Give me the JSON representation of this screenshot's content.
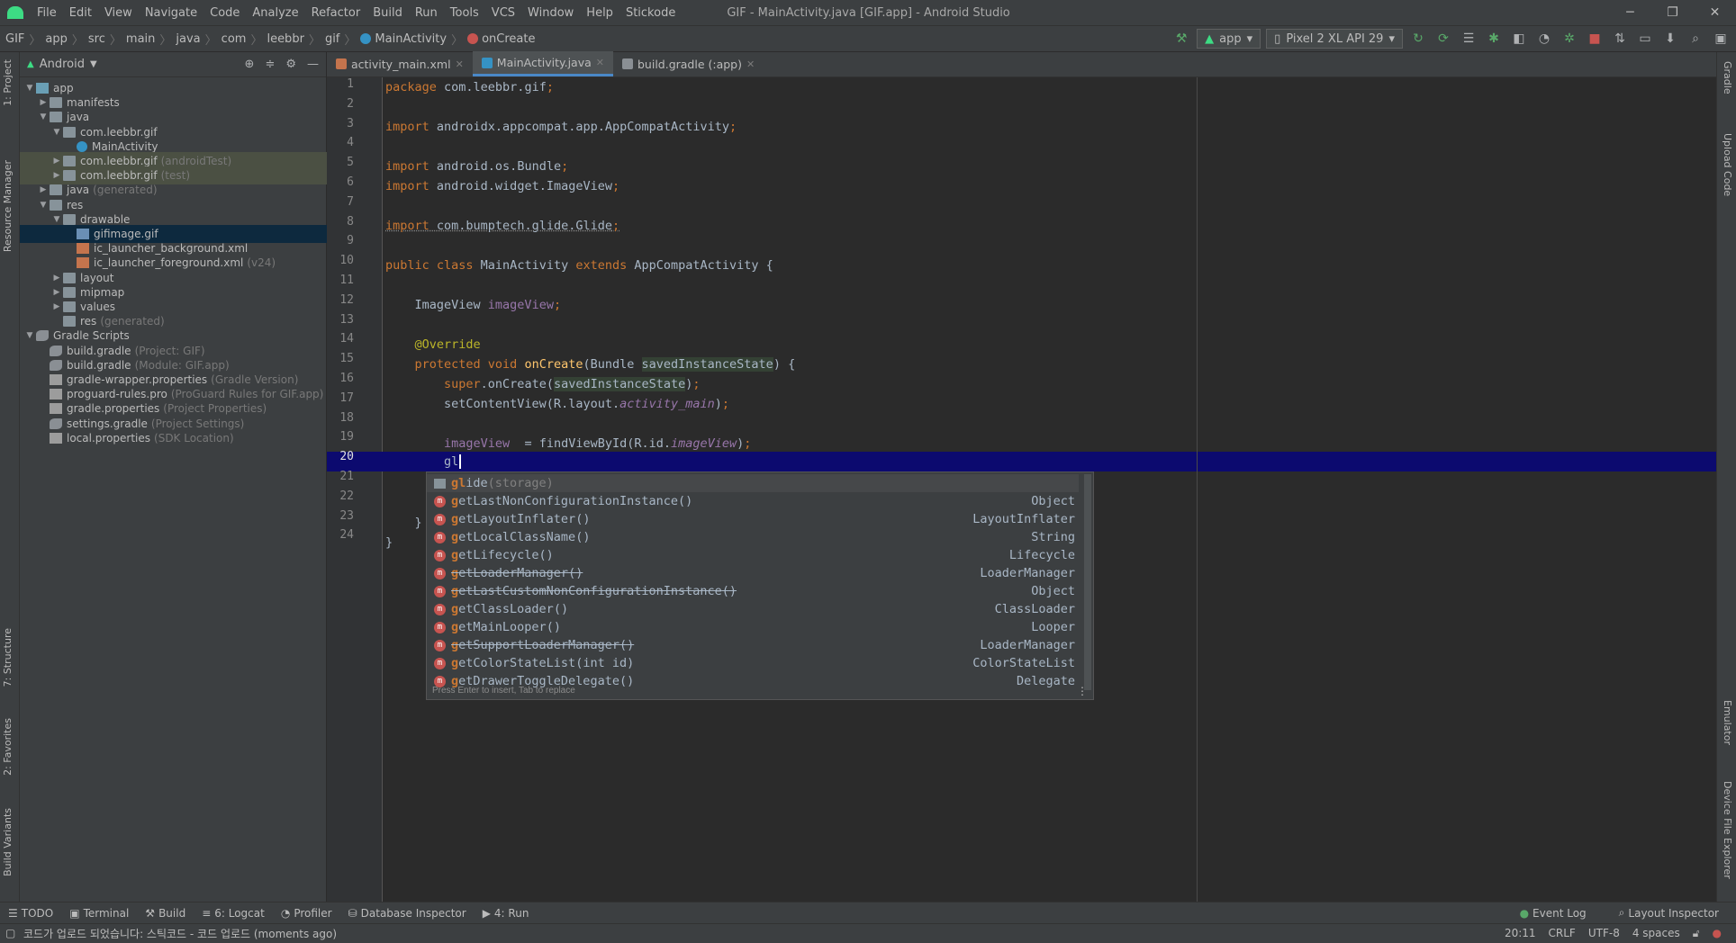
{
  "window": {
    "title": "GIF - MainActivity.java [GIF.app] - Android Studio",
    "menu": [
      "File",
      "Edit",
      "View",
      "Navigate",
      "Code",
      "Analyze",
      "Refactor",
      "Build",
      "Run",
      "Tools",
      "VCS",
      "Window",
      "Help",
      "Stickode"
    ],
    "controls": [
      "─",
      "❐",
      "✕"
    ]
  },
  "breadcrumb": [
    "GIF",
    "app",
    "src",
    "main",
    "java",
    "com",
    "leebbr",
    "gif",
    "MainActivity",
    "onCreate"
  ],
  "toolbar": {
    "config": "app",
    "device": "Pixel 2 XL API 29"
  },
  "side_tabs_left": [
    "1: Project",
    "Resource Manager",
    "7: Structure",
    "2: Favorites",
    "Build Variants"
  ],
  "side_tabs_right": [
    "Gradle",
    "Upload Code",
    "Emulator",
    "Device File Explorer"
  ],
  "project": {
    "view": "Android",
    "tree": [
      {
        "label": "app",
        "sub": "",
        "depth": 0,
        "arrow": "▼",
        "icon": "folder-blue"
      },
      {
        "label": "manifests",
        "sub": "",
        "depth": 1,
        "arrow": "▶",
        "icon": "folder"
      },
      {
        "label": "java",
        "sub": "",
        "depth": 1,
        "arrow": "▼",
        "icon": "folder"
      },
      {
        "label": "com.leebbr.gif",
        "sub": "",
        "depth": 2,
        "arrow": "▼",
        "icon": "folder"
      },
      {
        "label": "MainActivity",
        "sub": "",
        "depth": 3,
        "arrow": "",
        "icon": "jclass"
      },
      {
        "label": "com.leebbr.gif",
        "sub": "(androidTest)",
        "depth": 2,
        "arrow": "▶",
        "icon": "folder",
        "hl": "green"
      },
      {
        "label": "com.leebbr.gif",
        "sub": "(test)",
        "depth": 2,
        "arrow": "▶",
        "icon": "folder",
        "hl": "green"
      },
      {
        "label": "java",
        "sub": "(generated)",
        "depth": 1,
        "arrow": "▶",
        "icon": "folder"
      },
      {
        "label": "res",
        "sub": "",
        "depth": 1,
        "arrow": "▼",
        "icon": "folder"
      },
      {
        "label": "drawable",
        "sub": "",
        "depth": 2,
        "arrow": "▼",
        "icon": "folder"
      },
      {
        "label": "gifimage.gif",
        "sub": "",
        "depth": 3,
        "arrow": "",
        "icon": "gif",
        "hl": "sel"
      },
      {
        "label": "ic_launcher_background.xml",
        "sub": "",
        "depth": 3,
        "arrow": "",
        "icon": "xml"
      },
      {
        "label": "ic_launcher_foreground.xml",
        "sub": "(v24)",
        "depth": 3,
        "arrow": "",
        "icon": "xml"
      },
      {
        "label": "layout",
        "sub": "",
        "depth": 2,
        "arrow": "▶",
        "icon": "folder"
      },
      {
        "label": "mipmap",
        "sub": "",
        "depth": 2,
        "arrow": "▶",
        "icon": "folder"
      },
      {
        "label": "values",
        "sub": "",
        "depth": 2,
        "arrow": "▶",
        "icon": "folder"
      },
      {
        "label": "res",
        "sub": "(generated)",
        "depth": 2,
        "arrow": "",
        "icon": "folder"
      },
      {
        "label": "Gradle Scripts",
        "sub": "",
        "depth": 0,
        "arrow": "▼",
        "icon": "gradle"
      },
      {
        "label": "build.gradle",
        "sub": "(Project: GIF)",
        "depth": 1,
        "arrow": "",
        "icon": "gradle"
      },
      {
        "label": "build.gradle",
        "sub": "(Module: GIF.app)",
        "depth": 1,
        "arrow": "",
        "icon": "gradle"
      },
      {
        "label": "gradle-wrapper.properties",
        "sub": "(Gradle Version)",
        "depth": 1,
        "arrow": "",
        "icon": "prop"
      },
      {
        "label": "proguard-rules.pro",
        "sub": "(ProGuard Rules for GIF.app)",
        "depth": 1,
        "arrow": "",
        "icon": "prop"
      },
      {
        "label": "gradle.properties",
        "sub": "(Project Properties)",
        "depth": 1,
        "arrow": "",
        "icon": "prop"
      },
      {
        "label": "settings.gradle",
        "sub": "(Project Settings)",
        "depth": 1,
        "arrow": "",
        "icon": "gradle"
      },
      {
        "label": "local.properties",
        "sub": "(SDK Location)",
        "depth": 1,
        "arrow": "",
        "icon": "prop"
      }
    ]
  },
  "tabs": [
    {
      "label": "activity_main.xml",
      "active": false,
      "color": "#c4744d"
    },
    {
      "label": "MainActivity.java",
      "active": true,
      "color": "#3592c4"
    },
    {
      "label": "build.gradle (:app)",
      "active": false,
      "color": "#8a8f94"
    }
  ],
  "editor": {
    "current_line": 20,
    "line_numbers": [
      "1",
      "2",
      "3",
      "4",
      "5",
      "6",
      "7",
      "8",
      "9",
      "10",
      "11",
      "12",
      "13",
      "14",
      "15",
      "16",
      "17",
      "18",
      "19",
      "20",
      "21",
      "22",
      "23",
      "24"
    ]
  },
  "completion": {
    "items": [
      {
        "kind": "package",
        "prefix": "gl",
        "name": "ide",
        "params": "(storage)",
        "type": "",
        "deprecated": false
      },
      {
        "kind": "method",
        "prefix": "g",
        "name": "etLastNonConfigurationInstance",
        "params": "()",
        "type": "Object",
        "deprecated": false
      },
      {
        "kind": "method",
        "prefix": "g",
        "name": "etLayoutInflater",
        "params": "()",
        "type": "LayoutInflater",
        "deprecated": false
      },
      {
        "kind": "method",
        "prefix": "g",
        "name": "etLocalClassName",
        "params": "()",
        "type": "String",
        "deprecated": false
      },
      {
        "kind": "method",
        "prefix": "g",
        "name": "etLifecycle",
        "params": "()",
        "type": "Lifecycle",
        "deprecated": false
      },
      {
        "kind": "method",
        "prefix": "g",
        "name": "etLoaderManager",
        "params": "()",
        "type": "LoaderManager",
        "deprecated": true
      },
      {
        "kind": "method",
        "prefix": "g",
        "name": "etLastCustomNonConfigurationInstance",
        "params": "()",
        "type": "Object",
        "deprecated": true
      },
      {
        "kind": "method",
        "prefix": "g",
        "name": "etClassLoader",
        "params": "()",
        "type": "ClassLoader",
        "deprecated": false
      },
      {
        "kind": "method",
        "prefix": "g",
        "name": "etMainLooper",
        "params": "()",
        "type": "Looper",
        "deprecated": false
      },
      {
        "kind": "method",
        "prefix": "g",
        "name": "etSupportLoaderManager",
        "params": "()",
        "type": "LoaderManager",
        "deprecated": true
      },
      {
        "kind": "method",
        "prefix": "g",
        "name": "etColorStateList",
        "params": "(int id)",
        "type": "ColorStateList",
        "deprecated": false
      },
      {
        "kind": "method",
        "prefix": "g",
        "name": "etDrawerToggleDelegate",
        "params": "()",
        "type": "Delegate",
        "deprecated": false
      }
    ],
    "hint": "Press Enter to insert, Tab to replace"
  },
  "bottom_tools": [
    "TODO",
    "Terminal",
    "Build",
    "6: Logcat",
    "Profiler",
    "Database Inspector",
    "4: Run"
  ],
  "bottom_tools_right": [
    "Event Log",
    "Layout Inspector"
  ],
  "status": {
    "message": "코드가 업로드 되었습니다: 스틱코드 - 코드 업로드 (moments ago)",
    "position": "20:11",
    "line_sep": "CRLF",
    "encoding": "UTF-8",
    "indent": "4 spaces"
  }
}
